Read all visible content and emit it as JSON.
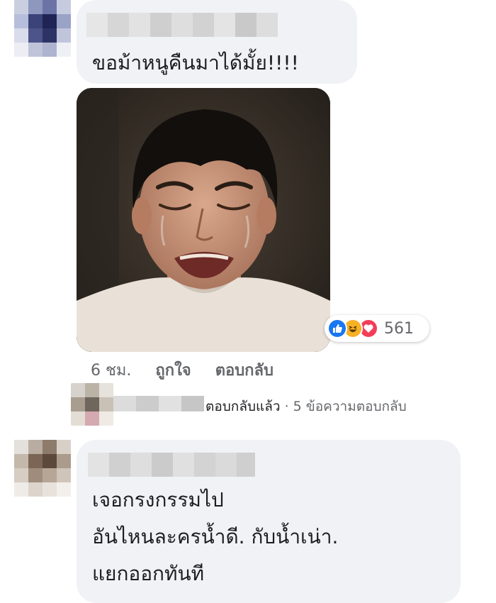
{
  "comments": [
    {
      "text_lines": [
        "ขอม้าหนูคืนมาได้มั้ย!!!!"
      ],
      "meta": {
        "time": "6 ชม.",
        "like_label": "ถูกใจ",
        "reply_label": "ตอบกลับ"
      },
      "reactions": {
        "icons": [
          "like-icon",
          "haha-icon",
          "love-icon"
        ],
        "count": "561"
      },
      "replies": {
        "replied_label": "ตอบกลับแล้ว",
        "separator": "·",
        "count_label": "5 ข้อความตอบกลับ"
      }
    },
    {
      "text_lines": [
        "เจอกรงกรรมไป",
        "อันไหนละครน้ำดี. กับน้ำเน่า.",
        "แยกออกทันที"
      ]
    }
  ],
  "colors": {
    "bubble": "#f0f2f5",
    "like": "#1877f2",
    "haha": "#f7b125",
    "love": "#f33e58",
    "meta_text": "#65676b"
  }
}
